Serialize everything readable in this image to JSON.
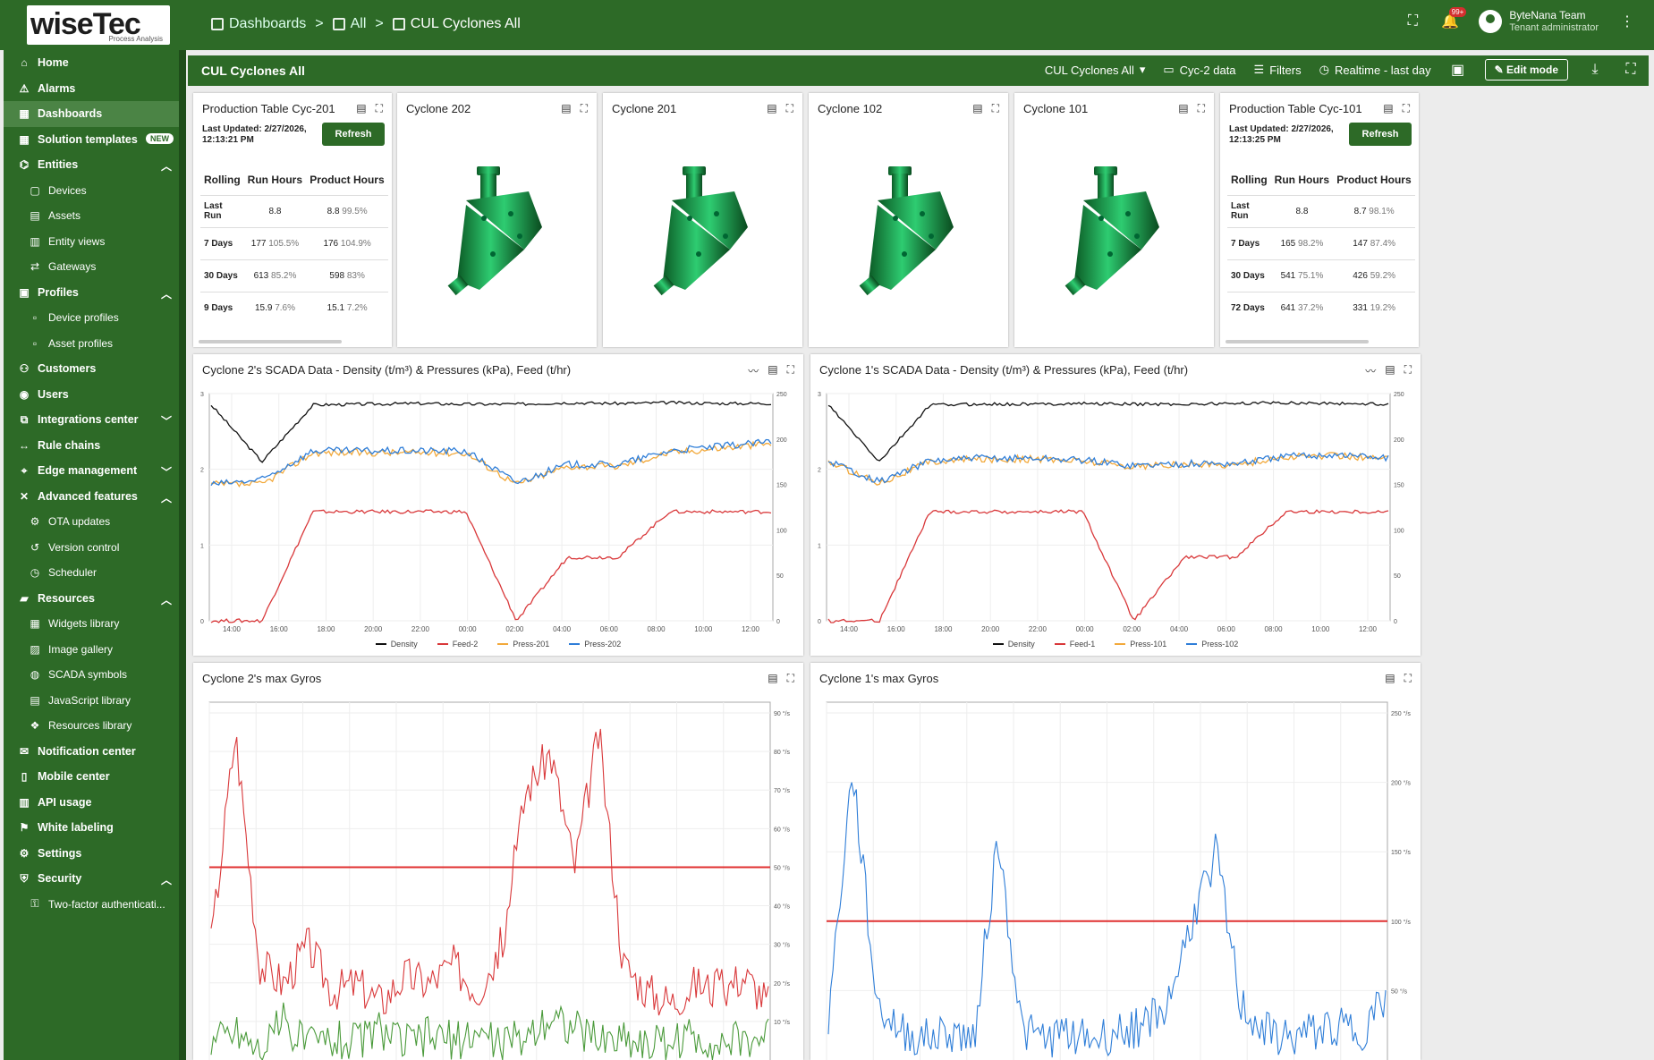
{
  "app": {
    "logo_text": "wiseTec",
    "logo_sub": "Process Analysis",
    "breadcrumbs": [
      "Dashboards",
      "All",
      "CUL Cyclones All"
    ],
    "notif_badge": "99+",
    "user_name": "ByteNana Team",
    "user_role": "Tenant administrator"
  },
  "sidebar": {
    "items": [
      {
        "label": "Home",
        "icon": "home-icon",
        "kind": "top"
      },
      {
        "label": "Alarms",
        "icon": "alarm-icon",
        "kind": "top"
      },
      {
        "label": "Dashboards",
        "icon": "dashboards-icon",
        "kind": "top",
        "active": true
      },
      {
        "label": "Solution templates",
        "icon": "templates-icon",
        "kind": "top",
        "badge": "NEW"
      },
      {
        "label": "Entities",
        "icon": "entities-icon",
        "kind": "top",
        "chevron": "up"
      },
      {
        "label": "Devices",
        "icon": "devices-icon",
        "kind": "sub"
      },
      {
        "label": "Assets",
        "icon": "assets-icon",
        "kind": "sub"
      },
      {
        "label": "Entity views",
        "icon": "entity-views-icon",
        "kind": "sub"
      },
      {
        "label": "Gateways",
        "icon": "gateways-icon",
        "kind": "sub"
      },
      {
        "label": "Profiles",
        "icon": "profiles-icon",
        "kind": "top",
        "chevron": "up"
      },
      {
        "label": "Device profiles",
        "icon": "device-profiles-icon",
        "kind": "sub"
      },
      {
        "label": "Asset profiles",
        "icon": "asset-profiles-icon",
        "kind": "sub"
      },
      {
        "label": "Customers",
        "icon": "customers-icon",
        "kind": "top"
      },
      {
        "label": "Users",
        "icon": "users-icon",
        "kind": "top"
      },
      {
        "label": "Integrations center",
        "icon": "integrations-icon",
        "kind": "top",
        "chevron": "down"
      },
      {
        "label": "Rule chains",
        "icon": "rule-chains-icon",
        "kind": "top"
      },
      {
        "label": "Edge management",
        "icon": "edge-icon",
        "kind": "top",
        "chevron": "down"
      },
      {
        "label": "Advanced features",
        "icon": "advanced-icon",
        "kind": "top",
        "chevron": "up"
      },
      {
        "label": "OTA updates",
        "icon": "ota-icon",
        "kind": "sub"
      },
      {
        "label": "Version control",
        "icon": "version-icon",
        "kind": "sub"
      },
      {
        "label": "Scheduler",
        "icon": "scheduler-icon",
        "kind": "sub"
      },
      {
        "label": "Resources",
        "icon": "resources-icon",
        "kind": "top",
        "chevron": "up"
      },
      {
        "label": "Widgets library",
        "icon": "widgets-icon",
        "kind": "sub"
      },
      {
        "label": "Image gallery",
        "icon": "image-icon",
        "kind": "sub"
      },
      {
        "label": "SCADA symbols",
        "icon": "scada-icon",
        "kind": "sub"
      },
      {
        "label": "JavaScript library",
        "icon": "js-icon",
        "kind": "sub"
      },
      {
        "label": "Resources library",
        "icon": "resources-library-icon",
        "kind": "sub"
      },
      {
        "label": "Notification center",
        "icon": "notification-icon",
        "kind": "top"
      },
      {
        "label": "Mobile center",
        "icon": "mobile-icon",
        "kind": "top"
      },
      {
        "label": "API usage",
        "icon": "api-icon",
        "kind": "top"
      },
      {
        "label": "White labeling",
        "icon": "white-label-icon",
        "kind": "top"
      },
      {
        "label": "Settings",
        "icon": "settings-icon",
        "kind": "top"
      },
      {
        "label": "Security",
        "icon": "security-icon",
        "kind": "top",
        "chevron": "up"
      },
      {
        "label": "Two-factor authenticati...",
        "icon": "two-factor-icon",
        "kind": "sub"
      }
    ]
  },
  "dashboard": {
    "title": "CUL Cyclones All",
    "state_select": "CUL Cyclones All",
    "entity_alias": "Cyc-2 data",
    "filters": "Filters",
    "timewindow": "Realtime - last day",
    "edit_mode": "Edit mode"
  },
  "prod_tables": [
    {
      "title": "Production Table Cyc-201",
      "updated": "Last Updated: 2/27/2026, 12:13:21 PM",
      "refresh": "Refresh",
      "headers": [
        "Rolling",
        "Run Hours",
        "Product Hours"
      ],
      "rows": [
        {
          "label": "Last Run",
          "run": "8.8",
          "run_pct": "",
          "prod": "8.8",
          "prod_pct": "99.5%"
        },
        {
          "label": "7 Days",
          "run": "177",
          "run_pct": "105.5%",
          "prod": "176",
          "prod_pct": "104.9%"
        },
        {
          "label": "30 Days",
          "run": "613",
          "run_pct": "85.2%",
          "prod": "598",
          "prod_pct": "83%"
        },
        {
          "label": "9 Days",
          "run": "15.9",
          "run_pct": "7.6%",
          "prod": "15.1",
          "prod_pct": "7.2%"
        }
      ]
    },
    {
      "title": "Production Table Cyc-101",
      "updated": "Last Updated: 2/27/2026, 12:13:25 PM",
      "refresh": "Refresh",
      "headers": [
        "Rolling",
        "Run Hours",
        "Product Hours"
      ],
      "rows": [
        {
          "label": "Last Run",
          "run": "8.8",
          "run_pct": "",
          "prod": "8.7",
          "prod_pct": "98.1%"
        },
        {
          "label": "7 Days",
          "run": "165",
          "run_pct": "98.2%",
          "prod": "147",
          "prod_pct": "87.4%"
        },
        {
          "label": "30 Days",
          "run": "541",
          "run_pct": "75.1%",
          "prod": "426",
          "prod_pct": "59.2%"
        },
        {
          "label": "72 Days",
          "run": "641",
          "run_pct": "37.2%",
          "prod": "331",
          "prod_pct": "19.2%"
        }
      ]
    }
  ],
  "cyclone_cards": [
    "Cyclone 202",
    "Cyclone 201",
    "Cyclone 102",
    "Cyclone 101"
  ],
  "colors": {
    "brand": "#2d6a27",
    "density": "#111111",
    "feed": "#d9383a",
    "press_a": "#f2a93b",
    "press_b": "#2f7ed8",
    "gyro_green": "#4a9a3a"
  },
  "chart_data": [
    {
      "type": "line",
      "title": "Cyclone 2's SCADA Data - Density (t/m³) & Pressures (kPa), Feed (t/hr)",
      "x": [
        "14:00",
        "16:00",
        "18:00",
        "20:00",
        "22:00",
        "00:00",
        "02:00",
        "04:00",
        "06:00",
        "08:00",
        "10:00",
        "12:00"
      ],
      "ylim_left": [
        0,
        3
      ],
      "yticks_left": [
        "0",
        "1",
        "2",
        "3"
      ],
      "ylim_right": [
        0,
        250
      ],
      "yticks_right": [
        "0",
        "50",
        "100",
        "150",
        "200",
        "250"
      ],
      "series": [
        {
          "name": "Density",
          "axis": "left",
          "values": [
            2.85,
            2.1,
            2.85,
            2.86,
            2.87,
            2.86,
            2.86,
            2.88,
            2.87,
            2.88,
            2.87,
            2.87
          ]
        },
        {
          "name": "Feed-2",
          "axis": "right",
          "values": [
            0,
            0,
            120,
            120,
            120,
            120,
            0,
            70,
            70,
            120,
            120,
            120
          ]
        },
        {
          "name": "Press-201",
          "axis": "right",
          "values": [
            150,
            150,
            185,
            185,
            185,
            185,
            150,
            170,
            170,
            185,
            190,
            195
          ]
        },
        {
          "name": "Press-202",
          "axis": "right",
          "values": [
            150,
            155,
            187,
            187,
            187,
            187,
            152,
            172,
            172,
            187,
            192,
            197
          ]
        }
      ],
      "legend": "bottom"
    },
    {
      "type": "line",
      "title": "Cyclone 1's SCADA Data - Density (t/m³) & Pressures (kPa), Feed (t/hr)",
      "x": [
        "14:00",
        "16:00",
        "18:00",
        "20:00",
        "22:00",
        "00:00",
        "02:00",
        "04:00",
        "06:00",
        "08:00",
        "10:00",
        "12:00"
      ],
      "ylim_left": [
        0,
        3
      ],
      "yticks_left": [
        "0",
        "1",
        "2",
        "3"
      ],
      "ylim_right": [
        0,
        250
      ],
      "yticks_right": [
        "0",
        "50",
        "100",
        "150",
        "200",
        "250"
      ],
      "series": [
        {
          "name": "Density",
          "axis": "left",
          "values": [
            2.85,
            2.1,
            2.85,
            2.86,
            2.86,
            2.87,
            2.86,
            2.86,
            2.87,
            2.88,
            2.87,
            2.86
          ]
        },
        {
          "name": "Feed-1",
          "axis": "right",
          "values": [
            0,
            0,
            120,
            120,
            120,
            120,
            0,
            70,
            70,
            120,
            120,
            120
          ]
        },
        {
          "name": "Press-101",
          "axis": "right",
          "values": [
            175,
            152,
            175,
            178,
            178,
            176,
            170,
            172,
            172,
            180,
            182,
            178
          ]
        },
        {
          "name": "Press-102",
          "axis": "right",
          "values": [
            176,
            153,
            176,
            179,
            179,
            177,
            171,
            173,
            173,
            181,
            183,
            179
          ]
        }
      ],
      "legend": "bottom"
    },
    {
      "type": "line",
      "title": "Cyclone 2's max Gyros",
      "ylim_right": [
        0,
        90
      ],
      "yticks_right": [
        "10 °/s",
        "20 °/s",
        "30 °/s",
        "40 °/s",
        "50 °/s",
        "60 °/s",
        "70 °/s",
        "80 °/s",
        "90 °/s"
      ],
      "threshold": 50,
      "series": [
        {
          "name": "",
          "values": [
            30,
            85,
            25,
            20,
            30,
            18,
            20,
            15,
            22,
            20,
            25,
            18,
            30,
            70,
            80,
            50,
            85,
            25,
            18,
            15,
            20,
            18,
            22,
            15
          ]
        },
        {
          "name": "",
          "values": [
            5,
            8,
            3,
            10,
            4,
            6,
            5,
            8,
            4,
            6,
            5,
            7,
            4,
            6,
            12,
            8,
            5,
            6,
            4,
            5,
            6,
            4,
            5,
            6
          ]
        }
      ]
    },
    {
      "type": "line",
      "title": "Cyclone 1's max Gyros",
      "ylim_right": [
        0,
        250
      ],
      "yticks_right": [
        "50 °/s",
        "100 °/s",
        "150 °/s",
        "200 °/s",
        "250 °/s"
      ],
      "threshold": 100,
      "series": [
        {
          "name": "",
          "values": [
            30,
            210,
            40,
            20,
            15,
            20,
            15,
            160,
            20,
            15,
            20,
            15,
            20,
            25,
            40,
            100,
            150,
            40,
            20,
            15,
            20,
            25,
            20,
            45
          ]
        }
      ]
    }
  ]
}
